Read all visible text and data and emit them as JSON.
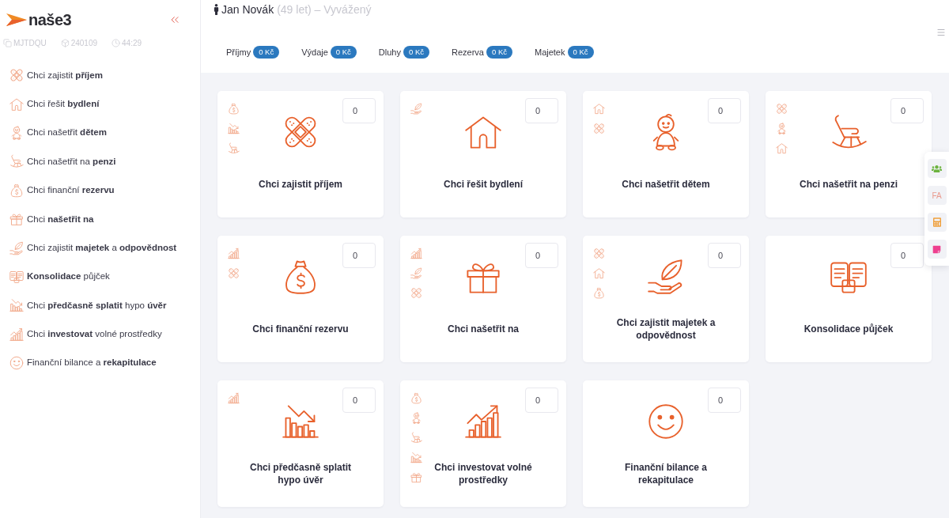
{
  "sidebar": {
    "logo": "naše3",
    "meta": [
      {
        "kind": "code",
        "text": "MJTDQU"
      },
      {
        "kind": "package",
        "text": "240109"
      },
      {
        "kind": "time",
        "text": "44:29"
      }
    ],
    "items": [
      {
        "kind": "income",
        "text": "Chci zajistit **příjem**"
      },
      {
        "kind": "housing",
        "text": "Chci řešit **bydlení**"
      },
      {
        "kind": "children",
        "text": "Chci našetřit **dětem**"
      },
      {
        "kind": "pension",
        "text": "Chci našetřit na **penzi**"
      },
      {
        "kind": "reserve",
        "text": "Chci finanční **rezervu**"
      },
      {
        "kind": "saving",
        "text": "Chci **našetřit na**"
      },
      {
        "kind": "property",
        "text": "Chci zajistit **majetek** a **odpovědnost**"
      },
      {
        "kind": "consolidation",
        "text": "**Konsolidace** půjček"
      },
      {
        "kind": "prepay",
        "text": "Chci **předčasně splatit** hypo **úvěr**"
      },
      {
        "kind": "invest",
        "text": "Chci **investovat** volné prostředky"
      },
      {
        "kind": "balance",
        "text": "Finanční bilance a **rekapitulace**"
      }
    ]
  },
  "header": {
    "name": "Jan Novák",
    "details": "(49 let) – Vyvážený",
    "totals": [
      {
        "label": "Příjmy",
        "value": "0 Kč"
      },
      {
        "label": "Výdaje",
        "value": "0 Kč"
      },
      {
        "label": "Dluhy",
        "value": "0 Kč"
      },
      {
        "label": "Rezerva",
        "value": "0 Kč"
      },
      {
        "label": "Majetek",
        "value": "0 Kč"
      }
    ]
  },
  "goals": [
    {
      "kind": "income",
      "title": "Chci zajistit příjem",
      "value": "0",
      "related": [
        {
          "kind": "reserve"
        },
        {
          "kind": "prepay"
        },
        {
          "kind": "pension"
        }
      ]
    },
    {
      "kind": "housing",
      "title": "Chci řešit bydlení",
      "value": "0",
      "related": [
        {
          "kind": "property"
        }
      ]
    },
    {
      "kind": "children",
      "title": "Chci našetřit dětem",
      "value": "0",
      "related": [
        {
          "kind": "housing"
        },
        {
          "kind": "income"
        }
      ]
    },
    {
      "kind": "pension",
      "title": "Chci našetřit na penzi",
      "value": "0",
      "related": [
        {
          "kind": "income"
        },
        {
          "kind": "children"
        },
        {
          "kind": "housing"
        }
      ]
    },
    {
      "kind": "reserve",
      "title": "Chci finanční rezervu",
      "value": "0",
      "related": [
        {
          "kind": "invest"
        },
        {
          "kind": "income"
        }
      ]
    },
    {
      "kind": "saving",
      "title": "Chci našetřit na",
      "value": "0",
      "related": [
        {
          "kind": "invest"
        },
        {
          "kind": "property"
        },
        {
          "kind": "income"
        }
      ]
    },
    {
      "kind": "property",
      "title": "Chci zajistit majetek a odpovědnost",
      "value": "0",
      "related": [
        {
          "kind": "income"
        },
        {
          "kind": "housing"
        },
        {
          "kind": "reserve"
        }
      ]
    },
    {
      "kind": "consolidation",
      "title": "Konsolidace půjček",
      "value": "0"
    },
    {
      "kind": "prepay",
      "title": "Chci předčasně splatit hypo úvěr",
      "value": "0",
      "related": [
        {
          "kind": "invest"
        }
      ]
    },
    {
      "kind": "invest",
      "title": "Chci investovat volné prostředky",
      "value": "0",
      "related": [
        {
          "kind": "reserve"
        },
        {
          "kind": "children"
        },
        {
          "kind": "pension"
        },
        {
          "kind": "prepay"
        },
        {
          "kind": "saving"
        }
      ]
    },
    {
      "kind": "balance",
      "title": "Finanční bilance a rekapitulace",
      "value": "0"
    }
  ],
  "quick_tools": [
    {
      "kind": "team"
    },
    {
      "kind": "initials",
      "text": "FA"
    },
    {
      "kind": "calculator"
    },
    {
      "kind": "note"
    }
  ]
}
